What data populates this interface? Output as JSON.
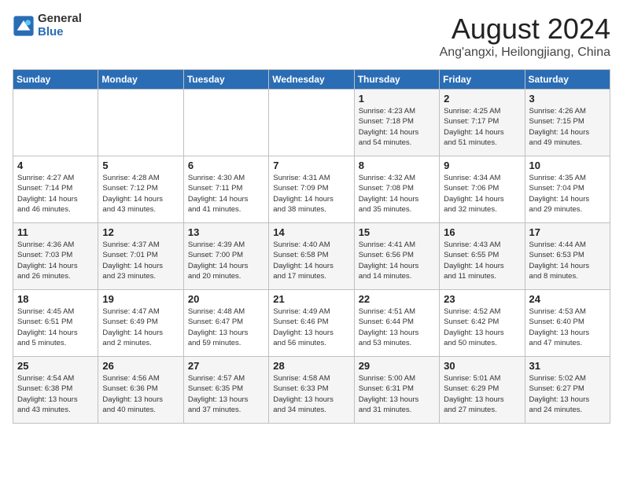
{
  "logo": {
    "general": "General",
    "blue": "Blue"
  },
  "title": {
    "month_year": "August 2024",
    "location": "Ang'angxi, Heilongjiang, China"
  },
  "weekdays": [
    "Sunday",
    "Monday",
    "Tuesday",
    "Wednesday",
    "Thursday",
    "Friday",
    "Saturday"
  ],
  "weeks": [
    [
      {
        "day": "",
        "info": ""
      },
      {
        "day": "",
        "info": ""
      },
      {
        "day": "",
        "info": ""
      },
      {
        "day": "",
        "info": ""
      },
      {
        "day": "1",
        "info": "Sunrise: 4:23 AM\nSunset: 7:18 PM\nDaylight: 14 hours\nand 54 minutes."
      },
      {
        "day": "2",
        "info": "Sunrise: 4:25 AM\nSunset: 7:17 PM\nDaylight: 14 hours\nand 51 minutes."
      },
      {
        "day": "3",
        "info": "Sunrise: 4:26 AM\nSunset: 7:15 PM\nDaylight: 14 hours\nand 49 minutes."
      }
    ],
    [
      {
        "day": "4",
        "info": "Sunrise: 4:27 AM\nSunset: 7:14 PM\nDaylight: 14 hours\nand 46 minutes."
      },
      {
        "day": "5",
        "info": "Sunrise: 4:28 AM\nSunset: 7:12 PM\nDaylight: 14 hours\nand 43 minutes."
      },
      {
        "day": "6",
        "info": "Sunrise: 4:30 AM\nSunset: 7:11 PM\nDaylight: 14 hours\nand 41 minutes."
      },
      {
        "day": "7",
        "info": "Sunrise: 4:31 AM\nSunset: 7:09 PM\nDaylight: 14 hours\nand 38 minutes."
      },
      {
        "day": "8",
        "info": "Sunrise: 4:32 AM\nSunset: 7:08 PM\nDaylight: 14 hours\nand 35 minutes."
      },
      {
        "day": "9",
        "info": "Sunrise: 4:34 AM\nSunset: 7:06 PM\nDaylight: 14 hours\nand 32 minutes."
      },
      {
        "day": "10",
        "info": "Sunrise: 4:35 AM\nSunset: 7:04 PM\nDaylight: 14 hours\nand 29 minutes."
      }
    ],
    [
      {
        "day": "11",
        "info": "Sunrise: 4:36 AM\nSunset: 7:03 PM\nDaylight: 14 hours\nand 26 minutes."
      },
      {
        "day": "12",
        "info": "Sunrise: 4:37 AM\nSunset: 7:01 PM\nDaylight: 14 hours\nand 23 minutes."
      },
      {
        "day": "13",
        "info": "Sunrise: 4:39 AM\nSunset: 7:00 PM\nDaylight: 14 hours\nand 20 minutes."
      },
      {
        "day": "14",
        "info": "Sunrise: 4:40 AM\nSunset: 6:58 PM\nDaylight: 14 hours\nand 17 minutes."
      },
      {
        "day": "15",
        "info": "Sunrise: 4:41 AM\nSunset: 6:56 PM\nDaylight: 14 hours\nand 14 minutes."
      },
      {
        "day": "16",
        "info": "Sunrise: 4:43 AM\nSunset: 6:55 PM\nDaylight: 14 hours\nand 11 minutes."
      },
      {
        "day": "17",
        "info": "Sunrise: 4:44 AM\nSunset: 6:53 PM\nDaylight: 14 hours\nand 8 minutes."
      }
    ],
    [
      {
        "day": "18",
        "info": "Sunrise: 4:45 AM\nSunset: 6:51 PM\nDaylight: 14 hours\nand 5 minutes."
      },
      {
        "day": "19",
        "info": "Sunrise: 4:47 AM\nSunset: 6:49 PM\nDaylight: 14 hours\nand 2 minutes."
      },
      {
        "day": "20",
        "info": "Sunrise: 4:48 AM\nSunset: 6:47 PM\nDaylight: 13 hours\nand 59 minutes."
      },
      {
        "day": "21",
        "info": "Sunrise: 4:49 AM\nSunset: 6:46 PM\nDaylight: 13 hours\nand 56 minutes."
      },
      {
        "day": "22",
        "info": "Sunrise: 4:51 AM\nSunset: 6:44 PM\nDaylight: 13 hours\nand 53 minutes."
      },
      {
        "day": "23",
        "info": "Sunrise: 4:52 AM\nSunset: 6:42 PM\nDaylight: 13 hours\nand 50 minutes."
      },
      {
        "day": "24",
        "info": "Sunrise: 4:53 AM\nSunset: 6:40 PM\nDaylight: 13 hours\nand 47 minutes."
      }
    ],
    [
      {
        "day": "25",
        "info": "Sunrise: 4:54 AM\nSunset: 6:38 PM\nDaylight: 13 hours\nand 43 minutes."
      },
      {
        "day": "26",
        "info": "Sunrise: 4:56 AM\nSunset: 6:36 PM\nDaylight: 13 hours\nand 40 minutes."
      },
      {
        "day": "27",
        "info": "Sunrise: 4:57 AM\nSunset: 6:35 PM\nDaylight: 13 hours\nand 37 minutes."
      },
      {
        "day": "28",
        "info": "Sunrise: 4:58 AM\nSunset: 6:33 PM\nDaylight: 13 hours\nand 34 minutes."
      },
      {
        "day": "29",
        "info": "Sunrise: 5:00 AM\nSunset: 6:31 PM\nDaylight: 13 hours\nand 31 minutes."
      },
      {
        "day": "30",
        "info": "Sunrise: 5:01 AM\nSunset: 6:29 PM\nDaylight: 13 hours\nand 27 minutes."
      },
      {
        "day": "31",
        "info": "Sunrise: 5:02 AM\nSunset: 6:27 PM\nDaylight: 13 hours\nand 24 minutes."
      }
    ]
  ]
}
